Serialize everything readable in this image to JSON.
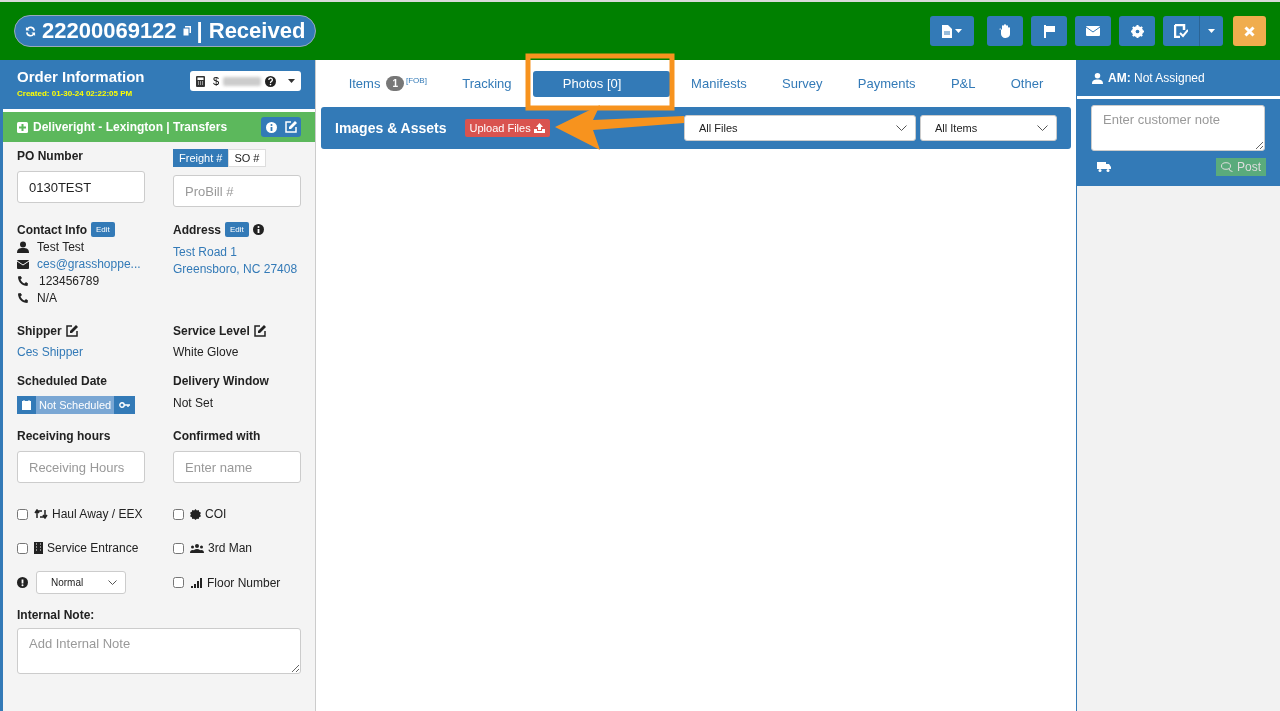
{
  "header": {
    "order_number": "22200069122",
    "separator": "|",
    "status": "Received"
  },
  "toolbar": [
    {
      "kind": "document-menu"
    },
    {
      "kind": "hand"
    },
    {
      "kind": "flag"
    },
    {
      "kind": "mail"
    },
    {
      "kind": "settings"
    },
    {
      "kind": "checklist-menu"
    },
    {
      "kind": "close"
    }
  ],
  "order_panel": {
    "title": "Order Information",
    "created": "Created: 01-30-24 02:22:05 PM",
    "price": "$"
  },
  "account": {
    "name": "Deliveright - Lexington | Transfers"
  },
  "po": {
    "label": "PO Number",
    "value": "0130TEST"
  },
  "reference_toggle": [
    {
      "label": "Freight #",
      "selected": true
    },
    {
      "label": "SO #",
      "selected": false
    }
  ],
  "probill": {
    "placeholder": "ProBill #"
  },
  "contact": {
    "label": "Contact Info",
    "edit": "Edit",
    "name": "Test Test",
    "email": "ces@grasshoppe...",
    "phone": "123456789",
    "phone_2": "N/A"
  },
  "address": {
    "label": "Address",
    "edit": "Edit",
    "lines": [
      "Test Road 1",
      "Greensboro, NC 27408"
    ]
  },
  "shipper": {
    "label": "Shipper",
    "value": "Ces Shipper"
  },
  "service_level": {
    "label": "Service Level",
    "value": "White Glove"
  },
  "scheduled_date": {
    "label": "Scheduled Date",
    "value": "Not Scheduled"
  },
  "delivery_window": {
    "label": "Delivery Window",
    "value": "Not Set"
  },
  "receiving_hours": {
    "label": "Receiving hours",
    "placeholder": "Receiving Hours"
  },
  "confirmed_with": {
    "label": "Confirmed with",
    "placeholder": "Enter name"
  },
  "options": [
    {
      "kind": "haul",
      "label": "Haul Away / EEX",
      "checked": false
    },
    {
      "kind": "coi",
      "label": "COI",
      "checked": false
    },
    {
      "kind": "entrance",
      "label": "Service Entrance",
      "checked": false
    },
    {
      "kind": "crew",
      "label": "3rd Man",
      "checked": false
    },
    {
      "kind": "priority",
      "value": "Normal"
    },
    {
      "kind": "floor",
      "label": "Floor Number",
      "checked": false
    }
  ],
  "internal_note": {
    "label": "Internal Note:",
    "placeholder": "Add Internal Note"
  },
  "tabs": [
    {
      "label": "Items",
      "badge": "1",
      "note": "[FOB]",
      "selected": false
    },
    {
      "label": "Tracking",
      "selected": false
    },
    {
      "label": "Photos [0]",
      "selected": true
    },
    {
      "label": "Manifests",
      "selected": false
    },
    {
      "label": "Survey",
      "selected": false
    },
    {
      "label": "Payments",
      "selected": false
    },
    {
      "label": "P&L",
      "selected": false
    },
    {
      "label": "Other",
      "selected": false
    }
  ],
  "assets": {
    "title": "Images & Assets",
    "upload": "Upload Files",
    "filters": [
      "All Files",
      "All Items"
    ]
  },
  "account_manager": {
    "label": "AM:",
    "value": "Not Assigned"
  },
  "customer_note": {
    "placeholder": "Enter customer note",
    "post": "Post"
  }
}
